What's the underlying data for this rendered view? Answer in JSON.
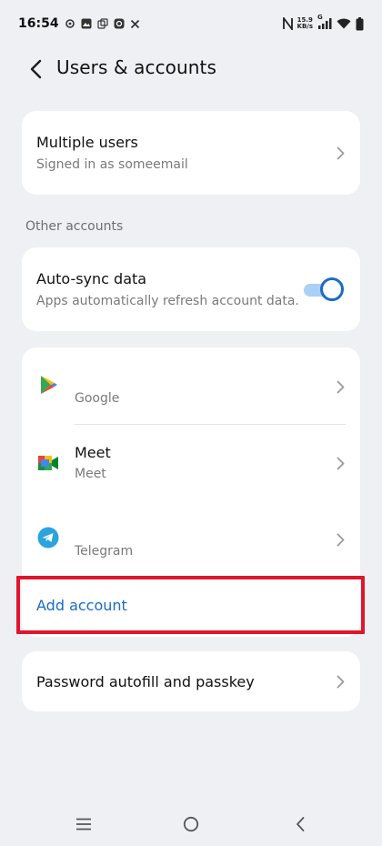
{
  "status_bar": {
    "time": "16:54",
    "net_speed_value": "15.9",
    "net_speed_unit": "KB/s",
    "signal_tag": "G",
    "icons": [
      "gear-icon",
      "image-icon",
      "copy-icon",
      "instagram-icon",
      "close-icon",
      "nfc-icon",
      "wifi-icon",
      "battery-icon"
    ]
  },
  "header": {
    "title": "Users & accounts"
  },
  "multiple_users": {
    "title": "Multiple users",
    "subtitle": "Signed in as someemail"
  },
  "section_other_accounts": "Other accounts",
  "auto_sync": {
    "title": "Auto-sync data",
    "subtitle": "Apps automatically refresh account data.",
    "enabled": true,
    "accent": "#1b6cc8"
  },
  "accounts": [
    {
      "name": "",
      "subtitle": "Google",
      "icon": "google-play-icon"
    },
    {
      "name": "Meet",
      "subtitle": "Meet",
      "icon": "google-meet-icon"
    },
    {
      "name": "",
      "subtitle": "Telegram",
      "icon": "telegram-icon"
    }
  ],
  "add_account_label": "Add account",
  "password_autofill": {
    "title": "Password autofill and passkey"
  },
  "colors": {
    "background": "#eff0f4",
    "card": "#ffffff",
    "link": "#1b6cc8",
    "highlight": "#e0152b"
  },
  "nav_bar": {
    "icons": [
      "menu-icon",
      "home-icon",
      "back-icon"
    ]
  }
}
